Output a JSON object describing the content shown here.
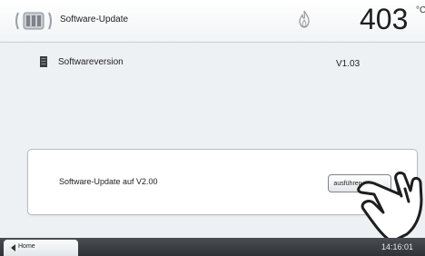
{
  "header": {
    "title": "Software-Update",
    "temperature": "403",
    "unit": "°C",
    "cassette_icon": "cassette-icon",
    "flame_icon": "flame-icon"
  },
  "version": {
    "label": "Softwareversion",
    "value": "V1.03",
    "icon": "document-icon"
  },
  "update_panel": {
    "label": "Software-Update auf V2.00",
    "button_label": "ausführen"
  },
  "footer": {
    "home_label": "Home",
    "time": "14:16:01"
  }
}
